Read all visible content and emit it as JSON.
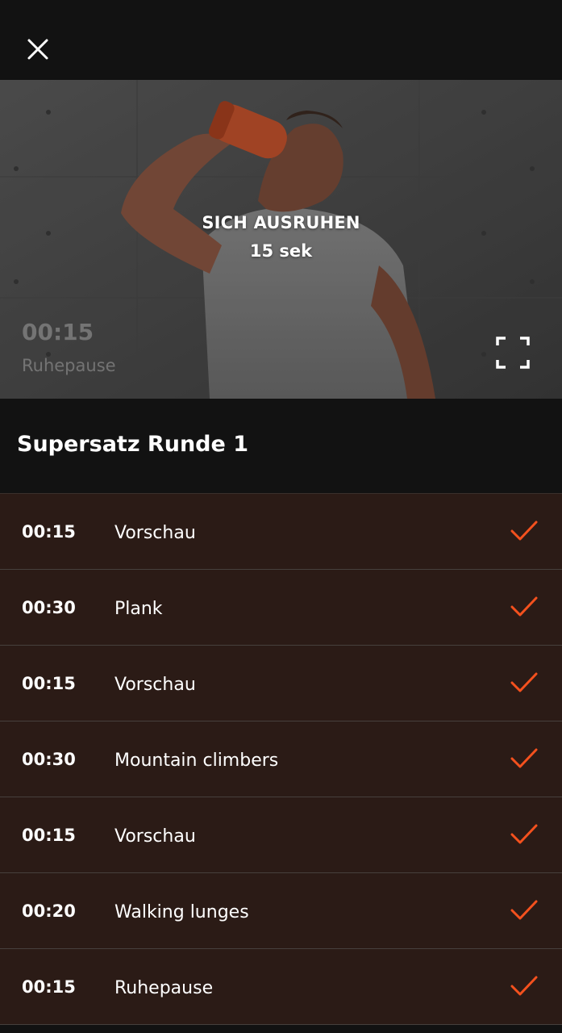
{
  "header": {
    "close_icon": "close-icon"
  },
  "video": {
    "title": "SICH AUSRUHEN",
    "subtitle": "15 sek",
    "timer": "00:15",
    "timer_label": "Ruhepause",
    "fullscreen_icon": "fullscreen-icon"
  },
  "section": {
    "title": "Supersatz Runde 1"
  },
  "exercises": [
    {
      "time": "00:15",
      "name": "Vorschau",
      "done": true
    },
    {
      "time": "00:30",
      "name": "Plank",
      "done": true
    },
    {
      "time": "00:15",
      "name": "Vorschau",
      "done": true
    },
    {
      "time": "00:30",
      "name": "Mountain climbers",
      "done": true
    },
    {
      "time": "00:15",
      "name": "Vorschau",
      "done": true
    },
    {
      "time": "00:20",
      "name": "Walking lunges",
      "done": true
    },
    {
      "time": "00:15",
      "name": "Ruhepause",
      "done": true
    }
  ],
  "colors": {
    "accent": "#f4511e",
    "row_bg": "#2b1b16",
    "page_bg": "#121212"
  }
}
